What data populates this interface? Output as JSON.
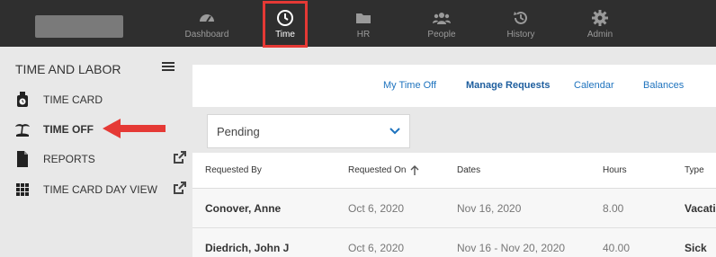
{
  "nav": {
    "items": [
      {
        "label": "Dashboard",
        "icon": "speedometer-icon"
      },
      {
        "label": "Time",
        "icon": "clock-icon",
        "active": true
      },
      {
        "label": "HR",
        "icon": "folder-icon"
      },
      {
        "label": "People",
        "icon": "people-icon"
      },
      {
        "label": "History",
        "icon": "history-icon"
      },
      {
        "label": "Admin",
        "icon": "gear-icon"
      }
    ],
    "highlight_color": "#e53935"
  },
  "sidebar": {
    "title": "TIME AND LABOR",
    "items": [
      {
        "label": "TIME CARD",
        "icon": "timecard-icon"
      },
      {
        "label": "TIME OFF",
        "icon": "island-icon",
        "active": true
      },
      {
        "label": "REPORTS",
        "icon": "document-icon",
        "external": true
      },
      {
        "label": "TIME CARD DAY VIEW",
        "icon": "grid-icon",
        "external": true
      }
    ]
  },
  "tabs": [
    {
      "label": "My Time Off"
    },
    {
      "label": "Manage Requests",
      "active": true
    },
    {
      "label": "Calendar"
    },
    {
      "label": "Balances"
    }
  ],
  "filter": {
    "value": "Pending"
  },
  "table": {
    "headers": [
      "Requested By",
      "Requested On",
      "Dates",
      "Hours",
      "Type"
    ],
    "sort_column": "Requested On",
    "rows": [
      {
        "name": "Conover, Anne",
        "requested_on": "Oct 6, 2020",
        "dates": "Nov 16, 2020",
        "hours": "8.00",
        "type": "Vacati"
      },
      {
        "name": "Diedrich, John J",
        "requested_on": "Oct 6, 2020",
        "dates": "Nov 16 - Nov 20, 2020",
        "hours": "40.00",
        "type": "Sick"
      }
    ]
  },
  "colors": {
    "accent": "#1e73be",
    "topbar": "#2f2f2f"
  }
}
